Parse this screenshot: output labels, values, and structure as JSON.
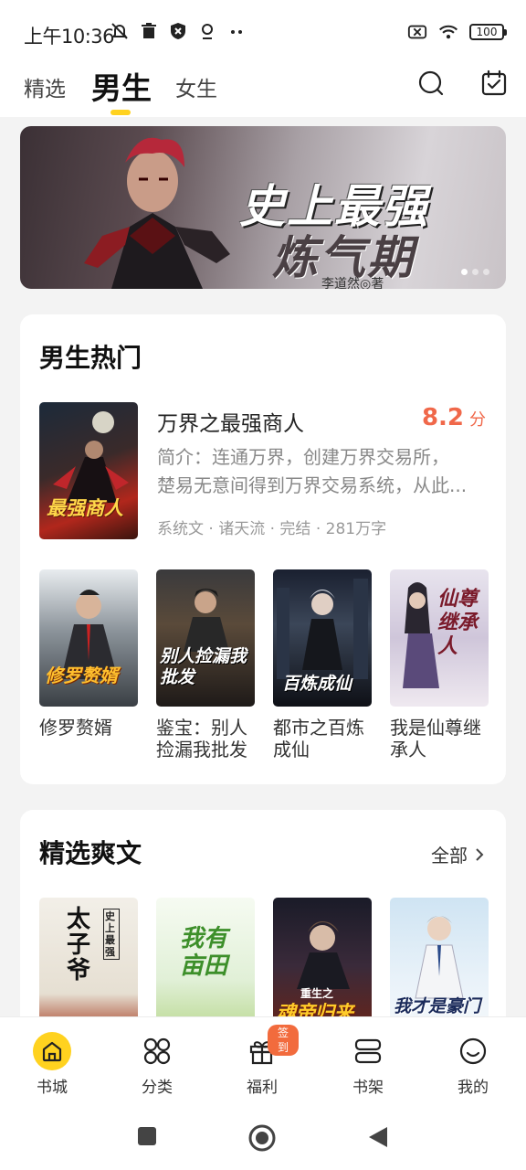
{
  "status_bar": {
    "time": "上午10:36",
    "battery": "100",
    "icons": [
      "notification-off-icon",
      "trash-icon",
      "shield-icon",
      "vpn-icon",
      "more-dots-icon",
      "sim-off-icon",
      "wifi-icon",
      "battery-icon"
    ]
  },
  "top_nav": {
    "tabs": [
      {
        "label": "精选",
        "active": false
      },
      {
        "label": "男生",
        "active": true
      },
      {
        "label": "女生",
        "active": false
      }
    ],
    "icons": [
      "search-icon",
      "calendar-check-icon"
    ]
  },
  "banner": {
    "title_line1": "史上最强",
    "title_line2": "炼气期",
    "author": "李道然◎著",
    "dots": 3,
    "active_dot": 0
  },
  "hot_section": {
    "title": "男生热门",
    "featured": {
      "cover_text": "最强商人",
      "name": "万界之最强商人",
      "score": "8.2",
      "score_unit": "分",
      "desc_line1": "简介：连通万界，创建万界交易所，",
      "desc_line2": "楚易无意间得到万界交易系统，从此...",
      "meta": "系统文 · 诸天流 · 完结 · 281万字"
    },
    "books": [
      {
        "name_line1": "修罗赘婿",
        "name_line2": "",
        "cover_text": "修罗赘婿"
      },
      {
        "name_line1": "鉴宝：别人",
        "name_line2": "捡漏我批发",
        "cover_text": "别人捡漏我批发"
      },
      {
        "name_line1": "都市之百炼",
        "name_line2": "成仙",
        "cover_text": "百炼成仙"
      },
      {
        "name_line1": "我是仙尊继",
        "name_line2": "承人",
        "cover_text": "仙尊继承人"
      }
    ]
  },
  "picks_section": {
    "title": "精选爽文",
    "see_all": "全部",
    "books": [
      {
        "cover_text": "太子爷",
        "cover_sub": "史上最强"
      },
      {
        "cover_text": "我有亩田",
        "cover_sub": ""
      },
      {
        "cover_text": "魂帝归来",
        "cover_sub": "重生之"
      },
      {
        "cover_text": "我才是豪门",
        "cover_sub": ""
      }
    ]
  },
  "bottom_nav": {
    "items": [
      {
        "label": "书城",
        "icon": "home-icon",
        "active": true
      },
      {
        "label": "分类",
        "icon": "category-icon",
        "active": false
      },
      {
        "label": "福利",
        "icon": "gift-icon",
        "active": false,
        "badge": "签到"
      },
      {
        "label": "书架",
        "icon": "bookshelf-icon",
        "active": false
      },
      {
        "label": "我的",
        "icon": "profile-icon",
        "active": false
      }
    ]
  },
  "colors": {
    "accent": "#ffd21f",
    "score": "#f0684a",
    "badge": "#f26b3d"
  }
}
